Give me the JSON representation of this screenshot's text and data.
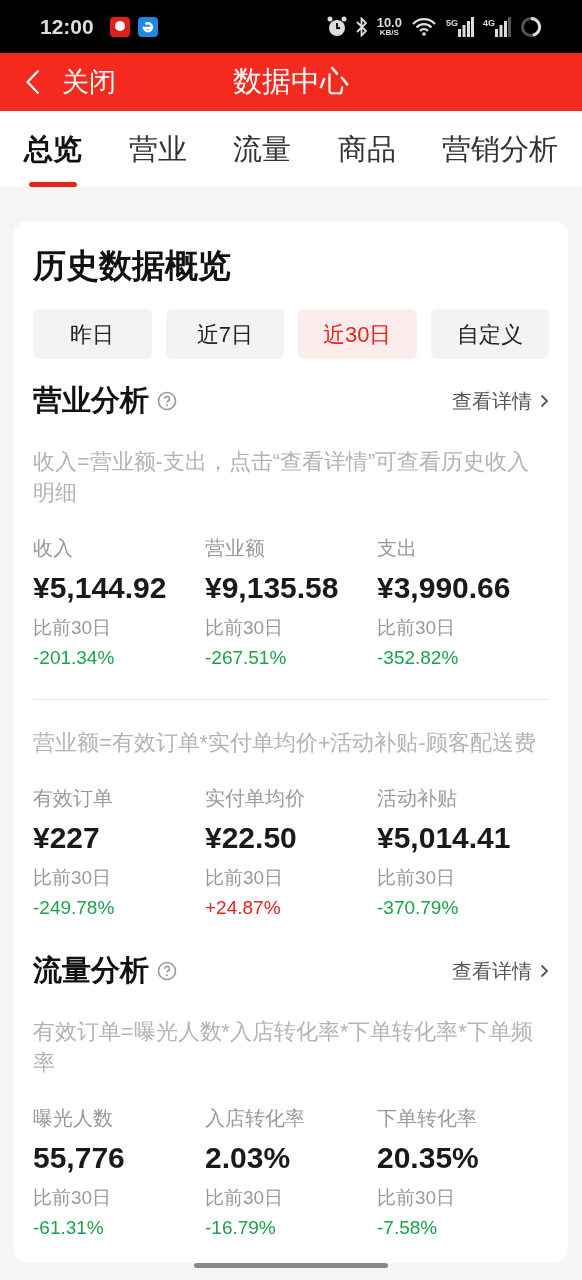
{
  "status_bar": {
    "time": "12:00",
    "network_speed": "10.0",
    "speed_unit": "KB/S",
    "signal_1_label": "5G",
    "signal_2_label": "4G"
  },
  "header": {
    "back_label": "关闭",
    "title": "数据中心"
  },
  "tabs": [
    {
      "label": "总览",
      "selected": true
    },
    {
      "label": "营业",
      "selected": false
    },
    {
      "label": "流量",
      "selected": false
    },
    {
      "label": "商品",
      "selected": false
    },
    {
      "label": "营销分析",
      "selected": false
    }
  ],
  "card": {
    "title": "历史数据概览",
    "periods": [
      {
        "label": "昨日",
        "selected": false
      },
      {
        "label": "近7日",
        "selected": false
      },
      {
        "label": "近30日",
        "selected": true
      },
      {
        "label": "自定义",
        "selected": false
      }
    ],
    "sections": [
      {
        "title": "营业分析",
        "link": "查看详情",
        "groups": [
          {
            "note": "收入=营业额-支出，点击“查看详情”可查看历史收入明细",
            "metrics": [
              {
                "label": "收入",
                "value": "¥5,144.92",
                "compare": "比前30日",
                "change": "-201.34%",
                "kind": "down"
              },
              {
                "label": "营业额",
                "value": "¥9,135.58",
                "compare": "比前30日",
                "change": "-267.51%",
                "kind": "down"
              },
              {
                "label": "支出",
                "value": "¥3,990.66",
                "compare": "比前30日",
                "change": "-352.82%",
                "kind": "down"
              }
            ]
          },
          {
            "note": "营业额=有效订单*实付单均价+活动补贴-顾客配送费",
            "metrics": [
              {
                "label": "有效订单",
                "value": "¥227",
                "compare": "比前30日",
                "change": "-249.78%",
                "kind": "down"
              },
              {
                "label": "实付单均价",
                "value": "¥22.50",
                "compare": "比前30日",
                "change": "+24.87%",
                "kind": "up"
              },
              {
                "label": "活动补贴",
                "value": "¥5,014.41",
                "compare": "比前30日",
                "change": "-370.79%",
                "kind": "down"
              }
            ]
          }
        ]
      },
      {
        "title": "流量分析",
        "link": "查看详情",
        "groups": [
          {
            "note": "有效订单=曝光人数*入店转化率*下单转化率*下单频率",
            "metrics": [
              {
                "label": "曝光人数",
                "value": "55,776",
                "compare": "比前30日",
                "change": "-61.31%",
                "kind": "down"
              },
              {
                "label": "入店转化率",
                "value": "2.03%",
                "compare": "比前30日",
                "change": "-16.79%",
                "kind": "down"
              },
              {
                "label": "下单转化率",
                "value": "20.35%",
                "compare": "比前30日",
                "change": "-7.58%",
                "kind": "down"
              }
            ]
          }
        ]
      }
    ]
  }
}
